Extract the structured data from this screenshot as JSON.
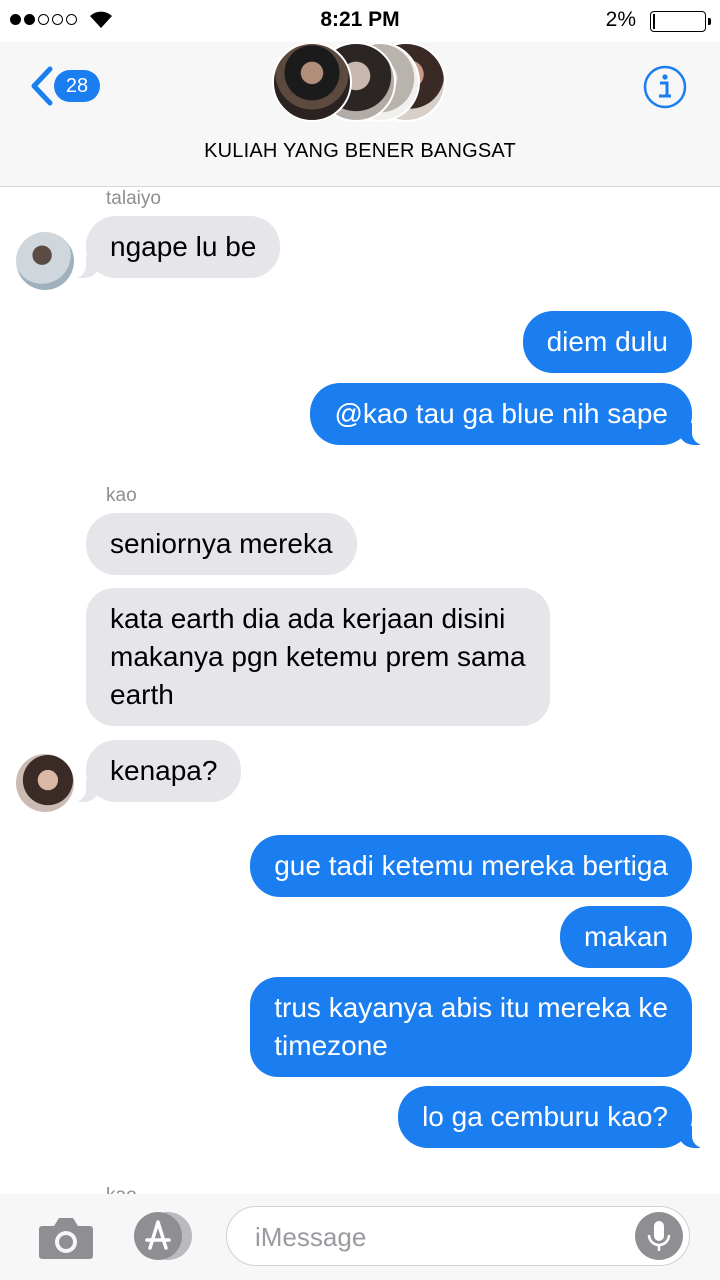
{
  "status_bar": {
    "time": "8:21 PM",
    "battery_percent": "2%",
    "battery_level": 0.02,
    "signal_bars": 2,
    "signal_total": 5
  },
  "header": {
    "back_count": "28",
    "group_name": "KULIAH YANG BENER BANGSAT",
    "info_icon": "info-icon",
    "back_icon": "chevron-left-icon"
  },
  "messages": [
    {
      "sender": "talaiyo",
      "text": "ngape lu be",
      "dir": "in"
    },
    {
      "text": "diem dulu",
      "dir": "out"
    },
    {
      "text": "@kao tau ga blue nih sape",
      "dir": "out"
    },
    {
      "sender": "kao",
      "text": "seniornya mereka",
      "dir": "in"
    },
    {
      "lines": [
        "kata earth dia ada kerjaan disini",
        "makanya pgn ketemu prem sama",
        "earth"
      ],
      "dir": "in"
    },
    {
      "text": "kenapa?",
      "dir": "in"
    },
    {
      "text": "gue tadi ketemu mereka bertiga",
      "dir": "out"
    },
    {
      "text": "makan",
      "dir": "out"
    },
    {
      "lines": [
        "trus kayanya abis itu mereka ke",
        "timezone"
      ],
      "dir": "out"
    },
    {
      "text": "lo ga cemburu kao?",
      "dir": "out"
    },
    {
      "sender": "kao",
      "dir": "in",
      "partial": true
    }
  ],
  "input_bar": {
    "placeholder": "iMessage",
    "camera_icon": "camera-icon",
    "apps_icon": "app-store-icon",
    "mic_icon": "microphone-icon"
  },
  "colors": {
    "accent": "#1a7ef0",
    "incoming": "#e5e5ea",
    "outgoing": "#1a7ef0",
    "header_bg": "#f7f7f7"
  }
}
